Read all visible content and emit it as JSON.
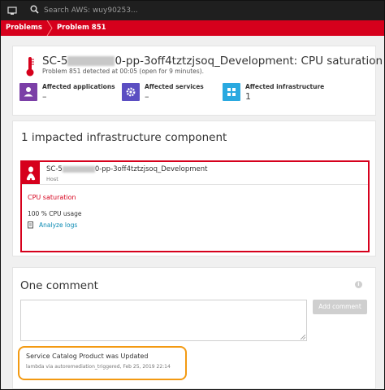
{
  "topbar": {
    "search_placeholder": "Search AWS: wuy90253..."
  },
  "breadcrumb": {
    "items": [
      "Problems",
      "Problem 851"
    ]
  },
  "problem": {
    "title_prefix": "SC-5",
    "title_suffix": "0-pp-3off4tztzjsoq_Development: CPU saturation",
    "subtitle": "Problem 851 detected at 00:05 (open for 9 minutes).",
    "affected": [
      {
        "label": "Affected applications",
        "value": "–",
        "icon": "user-icon",
        "color": "#7b3fa7"
      },
      {
        "label": "Affected services",
        "value": "–",
        "icon": "gear-icon",
        "color": "#5b4ec2"
      },
      {
        "label": "Affected infrastructure",
        "value": "1",
        "icon": "grid-icon",
        "color": "#2aa9e0"
      }
    ]
  },
  "impacted": {
    "heading": "1 impacted infrastructure component",
    "component": {
      "name_prefix": "SC-5",
      "name_suffix": "0-pp-3off4tztzjsoq_Development",
      "type": "Host",
      "problem": "CPU saturation",
      "usage": "100 % CPU usage",
      "link": "Analyze logs",
      "icon": "linux-icon"
    }
  },
  "comments": {
    "heading": "One comment",
    "add_button": "Add comment",
    "entry": {
      "text": "Service Catalog Product was Updated",
      "meta": "lambda via autoremediation_triggered, Feb 25, 2019 22:14"
    }
  },
  "colors": {
    "brand_red": "#d6001c",
    "highlight_orange": "#f39a12",
    "link_blue": "#0a8ab3"
  }
}
